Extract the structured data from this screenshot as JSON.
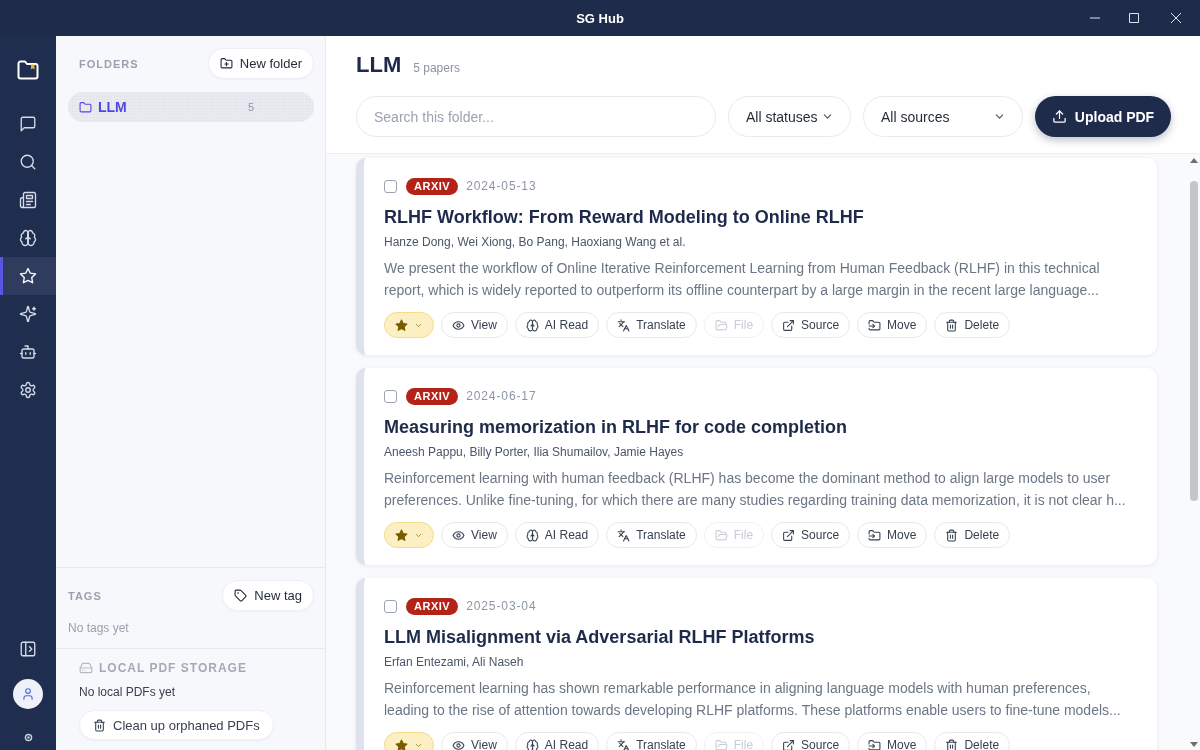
{
  "window": {
    "title": "SG Hub"
  },
  "rail": {
    "items": [
      {
        "selected": false
      },
      {
        "selected": false
      },
      {
        "selected": false
      },
      {
        "selected": false
      },
      {
        "selected": true
      },
      {
        "selected": false
      },
      {
        "selected": false
      },
      {
        "selected": false
      }
    ]
  },
  "folders_panel": {
    "heading": "FOLDERS",
    "new_folder_button": "New folder",
    "folders": [
      {
        "name": "LLM",
        "count": "5",
        "selected": true
      }
    ],
    "tags_heading": "TAGS",
    "new_tag_button": "New tag",
    "tags_empty": "No tags yet",
    "storage_heading": "LOCAL PDF STORAGE",
    "storage_empty": "No local PDFs yet",
    "cleanup_button": "Clean up orphaned PDFs"
  },
  "header": {
    "title": "LLM",
    "count": "5 papers",
    "search": {
      "placeholder": "Search this folder..."
    },
    "filters": [
      {
        "value": "All statuses"
      },
      {
        "value": "All sources"
      }
    ],
    "upload_button": "Upload PDF"
  },
  "papers": [
    {
      "checked": false,
      "source": "ARXIV",
      "date": "2024-05-13",
      "title": "RLHF Workflow: From Reward Modeling to Online RLHF",
      "authors": "Hanze Dong, Wei Xiong, Bo Pang, Haoxiang Wang et al.",
      "abstract": "We present the workflow of Online Iterative Reinforcement Learning from Human Feedback (RLHF) in this technical report, which is widely reported to outperform its offline counterpart by a large margin in the recent large language...",
      "starred": true,
      "actions": [
        {
          "label": "View",
          "disabled": false
        },
        {
          "label": "AI Read",
          "disabled": false
        },
        {
          "label": "Translate",
          "disabled": false
        },
        {
          "label": "File",
          "disabled": true
        },
        {
          "label": "Source",
          "disabled": false
        },
        {
          "label": "Move",
          "disabled": false
        },
        {
          "label": "Delete",
          "disabled": false
        }
      ]
    },
    {
      "checked": false,
      "source": "ARXIV",
      "date": "2024-06-17",
      "title": "Measuring memorization in RLHF for code completion",
      "authors": "Aneesh Pappu, Billy Porter, Ilia Shumailov, Jamie Hayes",
      "abstract": "Reinforcement learning with human feedback (RLHF) has become the dominant method to align large models to user preferences. Unlike fine-tuning, for which there are many studies regarding training data memorization, it is not clear h...",
      "starred": true,
      "actions": [
        {
          "label": "View",
          "disabled": false
        },
        {
          "label": "AI Read",
          "disabled": false
        },
        {
          "label": "Translate",
          "disabled": false
        },
        {
          "label": "File",
          "disabled": true
        },
        {
          "label": "Source",
          "disabled": false
        },
        {
          "label": "Move",
          "disabled": false
        },
        {
          "label": "Delete",
          "disabled": false
        }
      ]
    },
    {
      "checked": false,
      "source": "ARXIV",
      "date": "2025-03-04",
      "title": "LLM Misalignment via Adversarial RLHF Platforms",
      "authors": "Erfan Entezami, Ali Naseh",
      "abstract": "Reinforcement learning has shown remarkable performance in aligning language models with human preferences, leading to the rise of attention towards developing RLHF platforms. These platforms enable users to fine-tune models...",
      "starred": true,
      "actions": [
        {
          "label": "View",
          "disabled": false
        },
        {
          "label": "AI Read",
          "disabled": false
        },
        {
          "label": "Translate",
          "disabled": false
        },
        {
          "label": "File",
          "disabled": true
        },
        {
          "label": "Source",
          "disabled": false
        },
        {
          "label": "Move",
          "disabled": false
        },
        {
          "label": "Delete",
          "disabled": false
        }
      ]
    }
  ]
}
